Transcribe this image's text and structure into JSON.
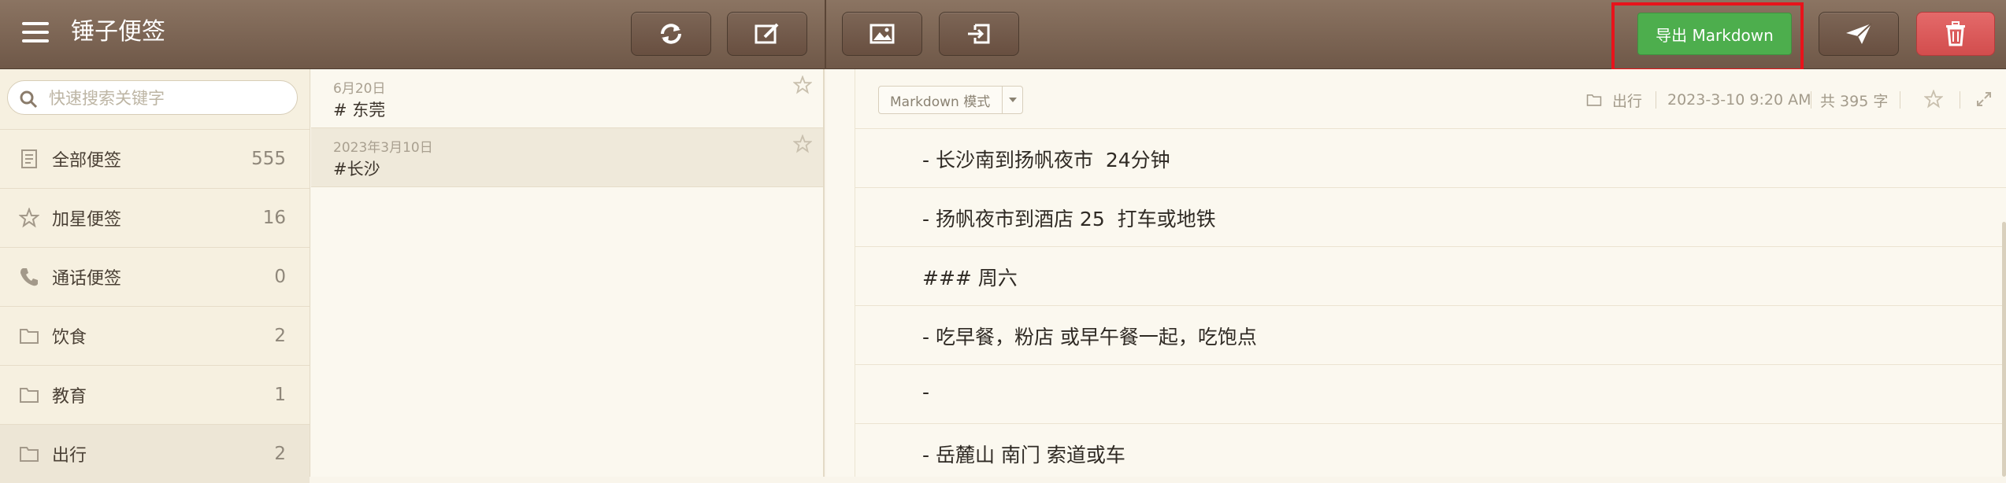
{
  "app": {
    "title": "锤子便签"
  },
  "toolbar": {
    "export_label": "导出 Markdown",
    "export_color": "#4dae4d",
    "delete_color": "#d95454",
    "icons": [
      "sync-icon",
      "edit-icon",
      "image-icon",
      "import-icon",
      "send-icon",
      "trash-icon"
    ]
  },
  "search": {
    "placeholder": "快速搜索关键字",
    "value": ""
  },
  "sidebar": {
    "items": [
      {
        "icon": "document-icon",
        "label": "全部便签",
        "count": "555"
      },
      {
        "icon": "star-icon",
        "label": "加星便签",
        "count": "16"
      },
      {
        "icon": "phone-icon",
        "label": "通话便签",
        "count": "0"
      },
      {
        "icon": "folder-icon",
        "label": "饮食",
        "count": "2"
      },
      {
        "icon": "folder-icon",
        "label": "教育",
        "count": "1"
      },
      {
        "icon": "folder-icon",
        "label": "出行",
        "count": "2",
        "active": true
      }
    ]
  },
  "notes": [
    {
      "date": "6月20日",
      "title": "# 东莞"
    },
    {
      "date": "2023年3月10日",
      "title": "#长沙",
      "active": true
    }
  ],
  "editor": {
    "mode": "Markdown 模式",
    "folder": "出行",
    "datetime": "2023-3-10 9:20 AM",
    "word_count": "共 395 字",
    "lines": [
      "- 长沙南到扬帆夜市  24分钟",
      "- 扬帆夜市到酒店 25  打车或地铁",
      "### 周六",
      "- 吃早餐，粉店 或早午餐一起，吃饱点",
      "-",
      "- 岳麓山 南门 索道或车"
    ]
  }
}
